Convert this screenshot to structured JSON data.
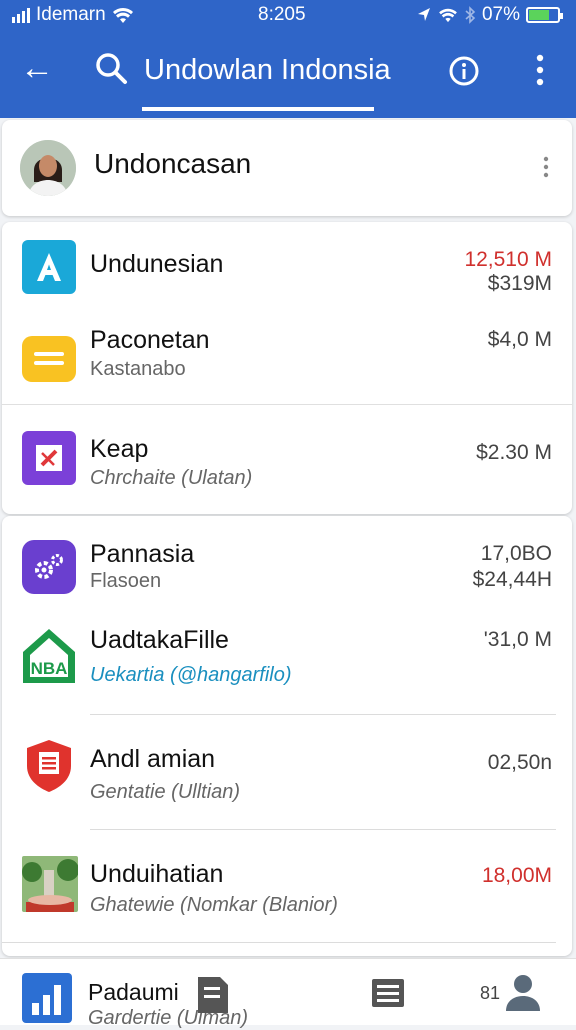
{
  "status_bar": {
    "carrier": "Idemarn",
    "time": "8:205",
    "battery": "07%",
    "battery_level": 0.7
  },
  "app_bar": {
    "title": "Undowlan Indonsia"
  },
  "header_card": {
    "name": "Undoncasan"
  },
  "list": [
    {
      "title": "Undunesian",
      "subtitle": "",
      "value1": "12,510 M",
      "value2": "$319M",
      "value1_color": "red",
      "icon": "a-letter-icon",
      "icon_bg": "#1aa8d8"
    },
    {
      "title": "Paconetan",
      "subtitle": "Kastanabo",
      "value1": "$4,0 M",
      "value2": "",
      "icon": "equals-icon",
      "icon_bg": "#f9c222"
    },
    {
      "title": "Keap",
      "subtitle": "Chrchaite (Ulatan)",
      "value1": "$2.30 M",
      "value2": "",
      "icon": "pencil-x-icon",
      "icon_bg": "#7b40d8"
    },
    {
      "title": "Pannasia",
      "subtitle": "Flasoen",
      "value1": "17,0BO",
      "value2": "$24,44H",
      "icon": "gears-icon",
      "icon_bg": "#6a3fcf"
    },
    {
      "title": "UadtakaFille",
      "subtitle": "Uekartia (@hangarfilo)",
      "value1": "'31,0 M",
      "value2": "",
      "icon": "house-nba-icon",
      "icon_bg": "#ffffff",
      "subtitle_link": true,
      "icon_text": "NBA"
    },
    {
      "title": "Andl amian",
      "subtitle": "Gentatie (Ulltian)",
      "value1": "02,50n",
      "value2": "",
      "icon": "shield-icon",
      "icon_bg": "#ffffff"
    },
    {
      "title": "Unduihatian",
      "subtitle": "Ghatewie (Nomkar (Blanior)",
      "value1": "18,00M",
      "value2": "",
      "value1_color": "red",
      "icon": "landscape-icon",
      "icon_bg": "#7a9a5a"
    }
  ],
  "bottom_bar": {
    "title": "Padaumi",
    "subtitle": "Gardertie (Ulman)",
    "number": "81"
  },
  "colors": {
    "primary": "#2f65c8",
    "red_value": "#d0302d",
    "link": "#1a8fbf"
  }
}
